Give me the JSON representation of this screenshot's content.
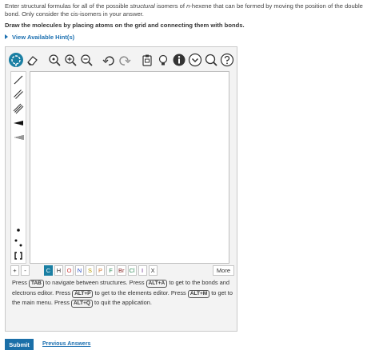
{
  "question": {
    "text_part1": "Enter structural formulas for all of the possible ",
    "text_emph": "structural",
    "text_part2": " isomers of ",
    "text_emph2": "n",
    "text_part3": "-hexene that can be formed by moving the position of the double bond. Only consider the cis-isomers in your answer."
  },
  "instruction": "Draw the molecules by placing atoms on the grid and connecting them with bonds.",
  "hint_label": "View Available Hint(s)",
  "toolbar_top": [
    "select-tool",
    "eraser-tool",
    "zoom-fit",
    "zoom-in",
    "zoom-out",
    "undo",
    "redo",
    "copy-paste",
    "explicit-hydrogens",
    "info",
    "menu",
    "search",
    "help"
  ],
  "atoms": {
    "add": "+",
    "sub": "-",
    "elements": [
      "C",
      "H",
      "O",
      "N",
      "S",
      "P",
      "F",
      "Br",
      "Cl",
      "I",
      "X"
    ],
    "element_colors": [
      "#ffffff",
      "#333333",
      "#d13a3a",
      "#2b4fc7",
      "#b59a00",
      "#d1742b",
      "#2e8b57",
      "#8b2b2b",
      "#2e8b57",
      "#6a2b8b",
      "#333333"
    ],
    "selected": "C",
    "more": "More"
  },
  "help": {
    "l1a": "Press ",
    "k1": "TAB",
    "l1b": " to navigate between structures. Press ",
    "k2": "ALT+A",
    "l1c": " to get to the bonds and",
    "l2a": "electrons editor. Press ",
    "k3": "ALT+P",
    "l2b": " to get to the elements editor. Press ",
    "k4": "ALT+M",
    "l2c": " to get to",
    "l3a": "the main menu. Press ",
    "k5": "ALT+Q",
    "l3b": " to quit the application."
  },
  "submit_label": "Submit",
  "previous_label": "Previous Answers",
  "colors": {
    "accent": "#1a7fa3",
    "link": "#1b6fb0",
    "submit": "#1a6fa8"
  }
}
